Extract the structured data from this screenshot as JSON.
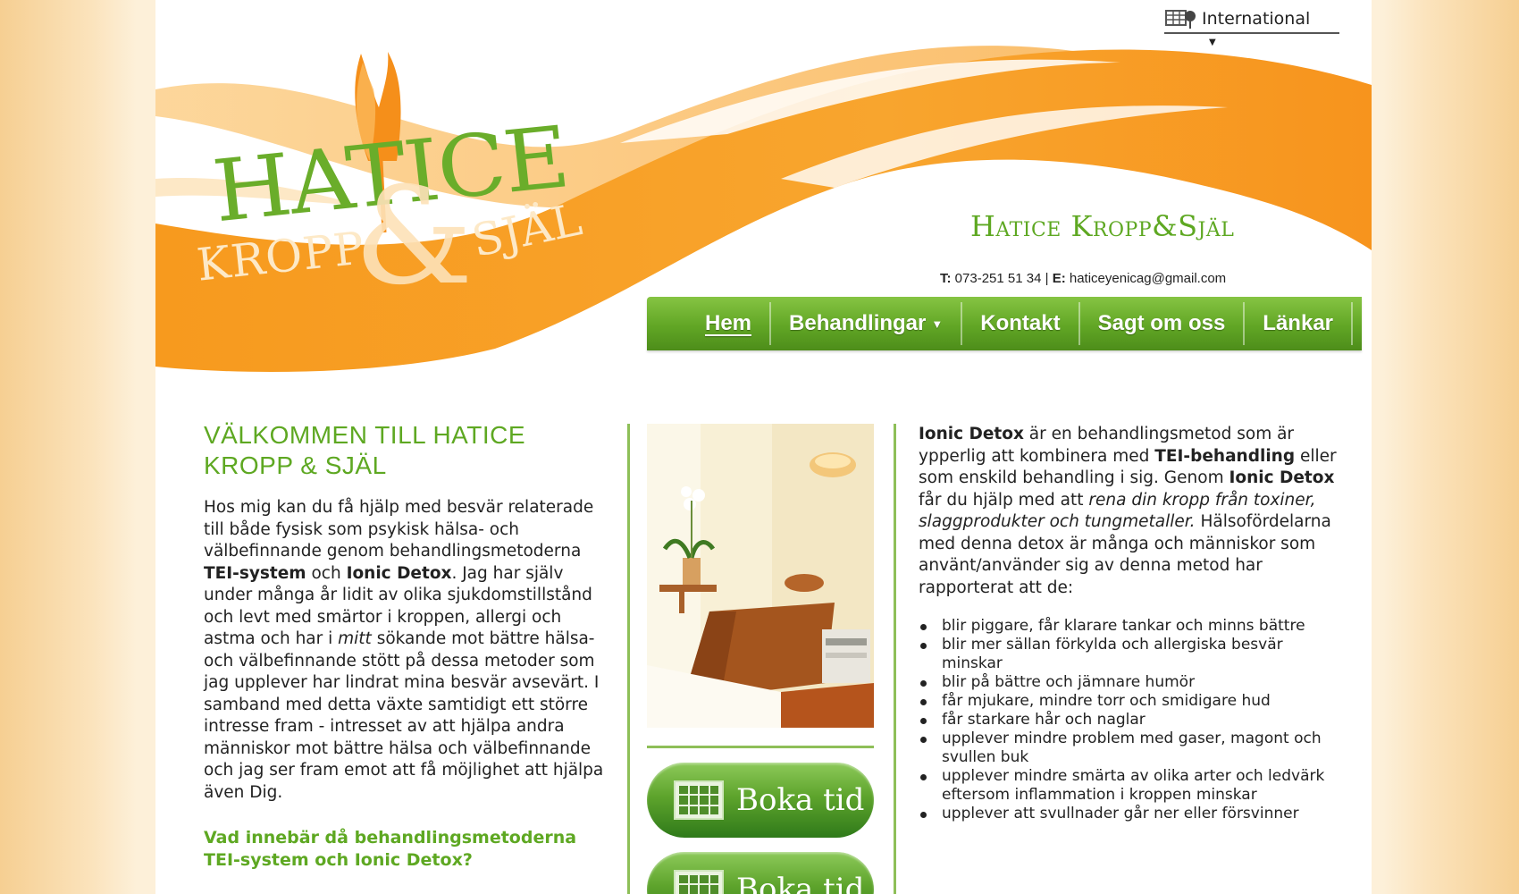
{
  "header": {
    "language_label": "International",
    "logo_line1": "HATICE",
    "logo_kropp": "KROPP",
    "logo_amp": "&",
    "logo_sjal": "SJÄL",
    "brand_name": "Hatice Kropp&Själ",
    "phone_label": "T:",
    "phone": "073-251 51 34",
    "separator": "|",
    "email_label": "E:",
    "email": "haticeyenicag@gmail.com"
  },
  "nav": {
    "items": [
      {
        "label": "Hem",
        "active": true
      },
      {
        "label": "Behandlingar",
        "dropdown": true
      },
      {
        "label": "Kontakt"
      },
      {
        "label": "Sagt om oss"
      },
      {
        "label": "Länkar"
      }
    ]
  },
  "left": {
    "heading": "VÄLKOMMEN TILL HATICE KROPP & SJÄL",
    "p1": "Hos mig kan du få hjälp med besvär relaterade till både fysisk som psykisk hälsa- och välbefinnande genom behandlingsmetoderna ",
    "p1_bold1": "TEI-system",
    "p1_and": " och ",
    "p1_bold2": "Ionic Detox",
    "p1_rest": ". Jag har själv under många år lidit av olika sjukdomstillstånd och levt med smärtor i kroppen, allergi och astma och har i ",
    "p1_italic": "mitt",
    "p1_end": " sökande mot bättre hälsa- och välbefinnande stött på dessa metoder som jag upplever har lindrat mina besvär avsevärt. I samband med detta växte samtidigt ett större intresse fram - intresset av att hjälpa andra människor mot bättre hälsa och välbefinnande och jag ser fram emot att få möjlighet att hjälpa även Dig.",
    "subheading": "Vad innebär då behandlingsmetoderna TEI-system och Ionic Detox?"
  },
  "middle": {
    "book_label": "Boka tid",
    "book_label_2": "Boka tid"
  },
  "right": {
    "b1": "Ionic Detox",
    "t1": " är en behandlingsmetod som är ypperlig att kombinera med ",
    "b2": "TEI-behandling",
    "t2": " eller som enskild behandling i sig. Genom ",
    "b3": "Ionic Detox",
    "t3": " får du hjälp med att ",
    "i1": "rena din kropp från toxiner, slaggprodukter och tungmetaller.",
    "t4": " Hälsofördelarna med denna detox är många och människor som använt/använder sig av denna metod har rapporterat att de:",
    "bullets": [
      "blir piggare, får klarare tankar och minns bättre",
      "blir mer sällan förkylda och allergiska besvär minskar",
      "blir på bättre och jämnare humör",
      "får mjukare, mindre torr och smidigare hud",
      "får starkare hår och naglar",
      "upplever mindre problem med gaser, magont och svullen buk",
      "upplever mindre smärta av olika arter och ledvärk eftersom inflammation i kroppen minskar",
      "upplever att svullnader går ner eller försvinner"
    ]
  },
  "colors": {
    "green": "#5ea822",
    "orange": "#f7941d",
    "nav_green": "#61a625"
  }
}
